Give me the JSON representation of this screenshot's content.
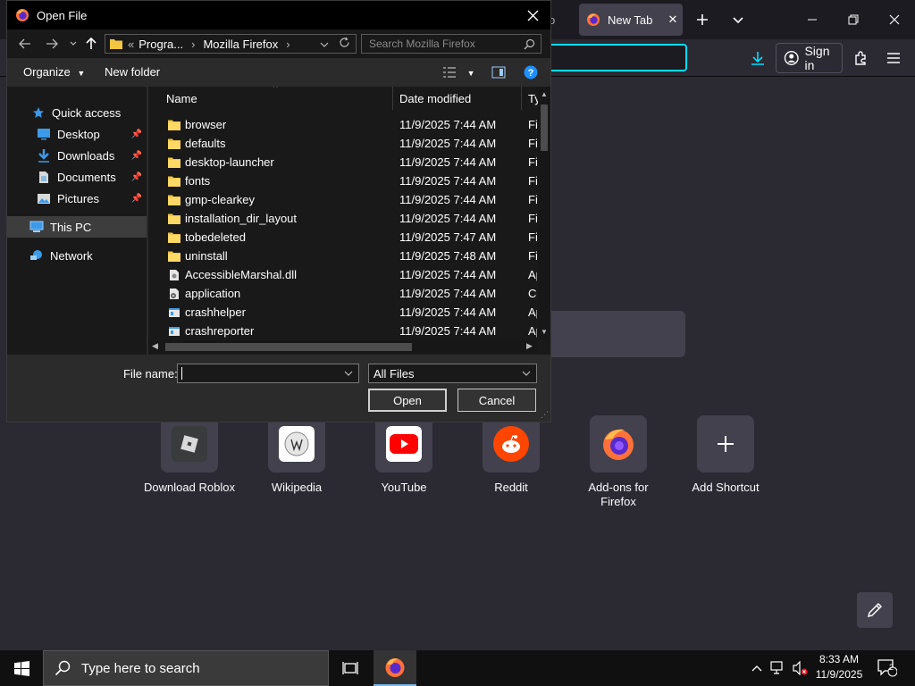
{
  "firefox": {
    "partial_tab_label": "Fo",
    "active_tab_label": "New Tab",
    "sign_in_label": "Sign in",
    "shortcuts": [
      {
        "label": "Download Roblox",
        "icon": "roblox-icon"
      },
      {
        "label": "Wikipedia",
        "icon": "wikipedia-icon"
      },
      {
        "label": "YouTube",
        "icon": "youtube-icon"
      },
      {
        "label": "Reddit",
        "icon": "reddit-icon"
      },
      {
        "label": "Add-ons for Firefox",
        "icon": "firefox-icon"
      },
      {
        "label": "Add Shortcut",
        "icon": "plus-icon"
      }
    ]
  },
  "dialog": {
    "title": "Open File",
    "breadcrumb": {
      "overflow": "«",
      "segments": [
        "Progra...",
        "Mozilla Firefox"
      ]
    },
    "search_placeholder": "Search Mozilla Firefox",
    "toolbar": {
      "organize": "Organize",
      "new_folder": "New folder"
    },
    "nav": [
      {
        "label": "Quick access",
        "icon": "star-icon"
      },
      {
        "label": "Desktop",
        "icon": "desktop-icon",
        "pinned": true
      },
      {
        "label": "Downloads",
        "icon": "download-icon",
        "pinned": true
      },
      {
        "label": "Documents",
        "icon": "documents-icon",
        "pinned": true
      },
      {
        "label": "Pictures",
        "icon": "pictures-icon",
        "pinned": true
      },
      {
        "label": "This PC",
        "icon": "computer-icon",
        "selected": true
      },
      {
        "label": "Network",
        "icon": "network-icon"
      }
    ],
    "columns": [
      "Name",
      "Date modified",
      "Ty"
    ],
    "files": [
      {
        "name": "browser",
        "date": "11/9/2025 7:44 AM",
        "type": "Fi",
        "kind": "folder"
      },
      {
        "name": "defaults",
        "date": "11/9/2025 7:44 AM",
        "type": "Fi",
        "kind": "folder"
      },
      {
        "name": "desktop-launcher",
        "date": "11/9/2025 7:44 AM",
        "type": "Fi",
        "kind": "folder"
      },
      {
        "name": "fonts",
        "date": "11/9/2025 7:44 AM",
        "type": "Fi",
        "kind": "folder"
      },
      {
        "name": "gmp-clearkey",
        "date": "11/9/2025 7:44 AM",
        "type": "Fi",
        "kind": "folder"
      },
      {
        "name": "installation_dir_layout",
        "date": "11/9/2025 7:44 AM",
        "type": "Fi",
        "kind": "folder"
      },
      {
        "name": "tobedeleted",
        "date": "11/9/2025 7:47 AM",
        "type": "Fi",
        "kind": "folder"
      },
      {
        "name": "uninstall",
        "date": "11/9/2025 7:48 AM",
        "type": "Fi",
        "kind": "folder"
      },
      {
        "name": "AccessibleMarshal.dll",
        "date": "11/9/2025 7:44 AM",
        "type": "Ap",
        "kind": "dll"
      },
      {
        "name": "application",
        "date": "11/9/2025 7:44 AM",
        "type": "Co",
        "kind": "config"
      },
      {
        "name": "crashhelper",
        "date": "11/9/2025 7:44 AM",
        "type": "Ap",
        "kind": "exe"
      },
      {
        "name": "crashreporter",
        "date": "11/9/2025 7:44 AM",
        "type": "Ap",
        "kind": "exe"
      }
    ],
    "file_name_label": "File name:",
    "file_name_value": "",
    "file_type": "All Files",
    "open_label": "Open",
    "cancel_label": "Cancel"
  },
  "taskbar": {
    "search_placeholder": "Type here to search",
    "time": "8:33 AM",
    "date": "11/9/2025",
    "notification_count": "2"
  }
}
